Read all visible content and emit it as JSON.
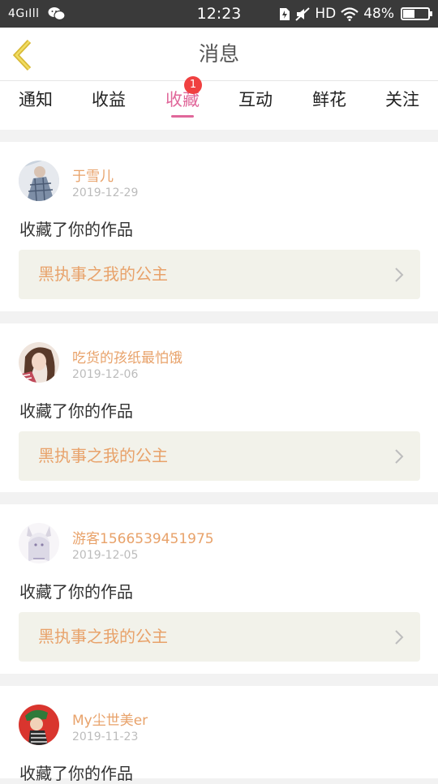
{
  "status_bar": {
    "signal": "4G",
    "time": "12:23",
    "network": "HD",
    "battery": "48%",
    "battery_level": 0.48
  },
  "header": {
    "title": "消息"
  },
  "tabs": [
    {
      "label": "通知",
      "active": false
    },
    {
      "label": "收益",
      "active": false
    },
    {
      "label": "收藏",
      "active": true,
      "badge": "1"
    },
    {
      "label": "互动",
      "active": false
    },
    {
      "label": "鲜花",
      "active": false
    },
    {
      "label": "关注",
      "active": false
    }
  ],
  "notifications": [
    {
      "user": "于雪儿",
      "date": "2019-12-29",
      "action": "收藏了你的作品",
      "work": "黑执事之我的公主"
    },
    {
      "user": "吃货的孩纸最怕饿",
      "date": "2019-12-06",
      "action": "收藏了你的作品",
      "work": "黑执事之我的公主"
    },
    {
      "user": "游客1566539451975",
      "date": "2019-12-05",
      "action": "收藏了你的作品",
      "work": "黑执事之我的公主"
    },
    {
      "user": "My尘世美er",
      "date": "2019-11-23",
      "action": "收藏了你的作品",
      "work": ""
    }
  ],
  "colors": {
    "accent": "#e0679a",
    "username": "#e8a26a",
    "badge": "#f04040",
    "back_arrow": "#e8c63a"
  }
}
